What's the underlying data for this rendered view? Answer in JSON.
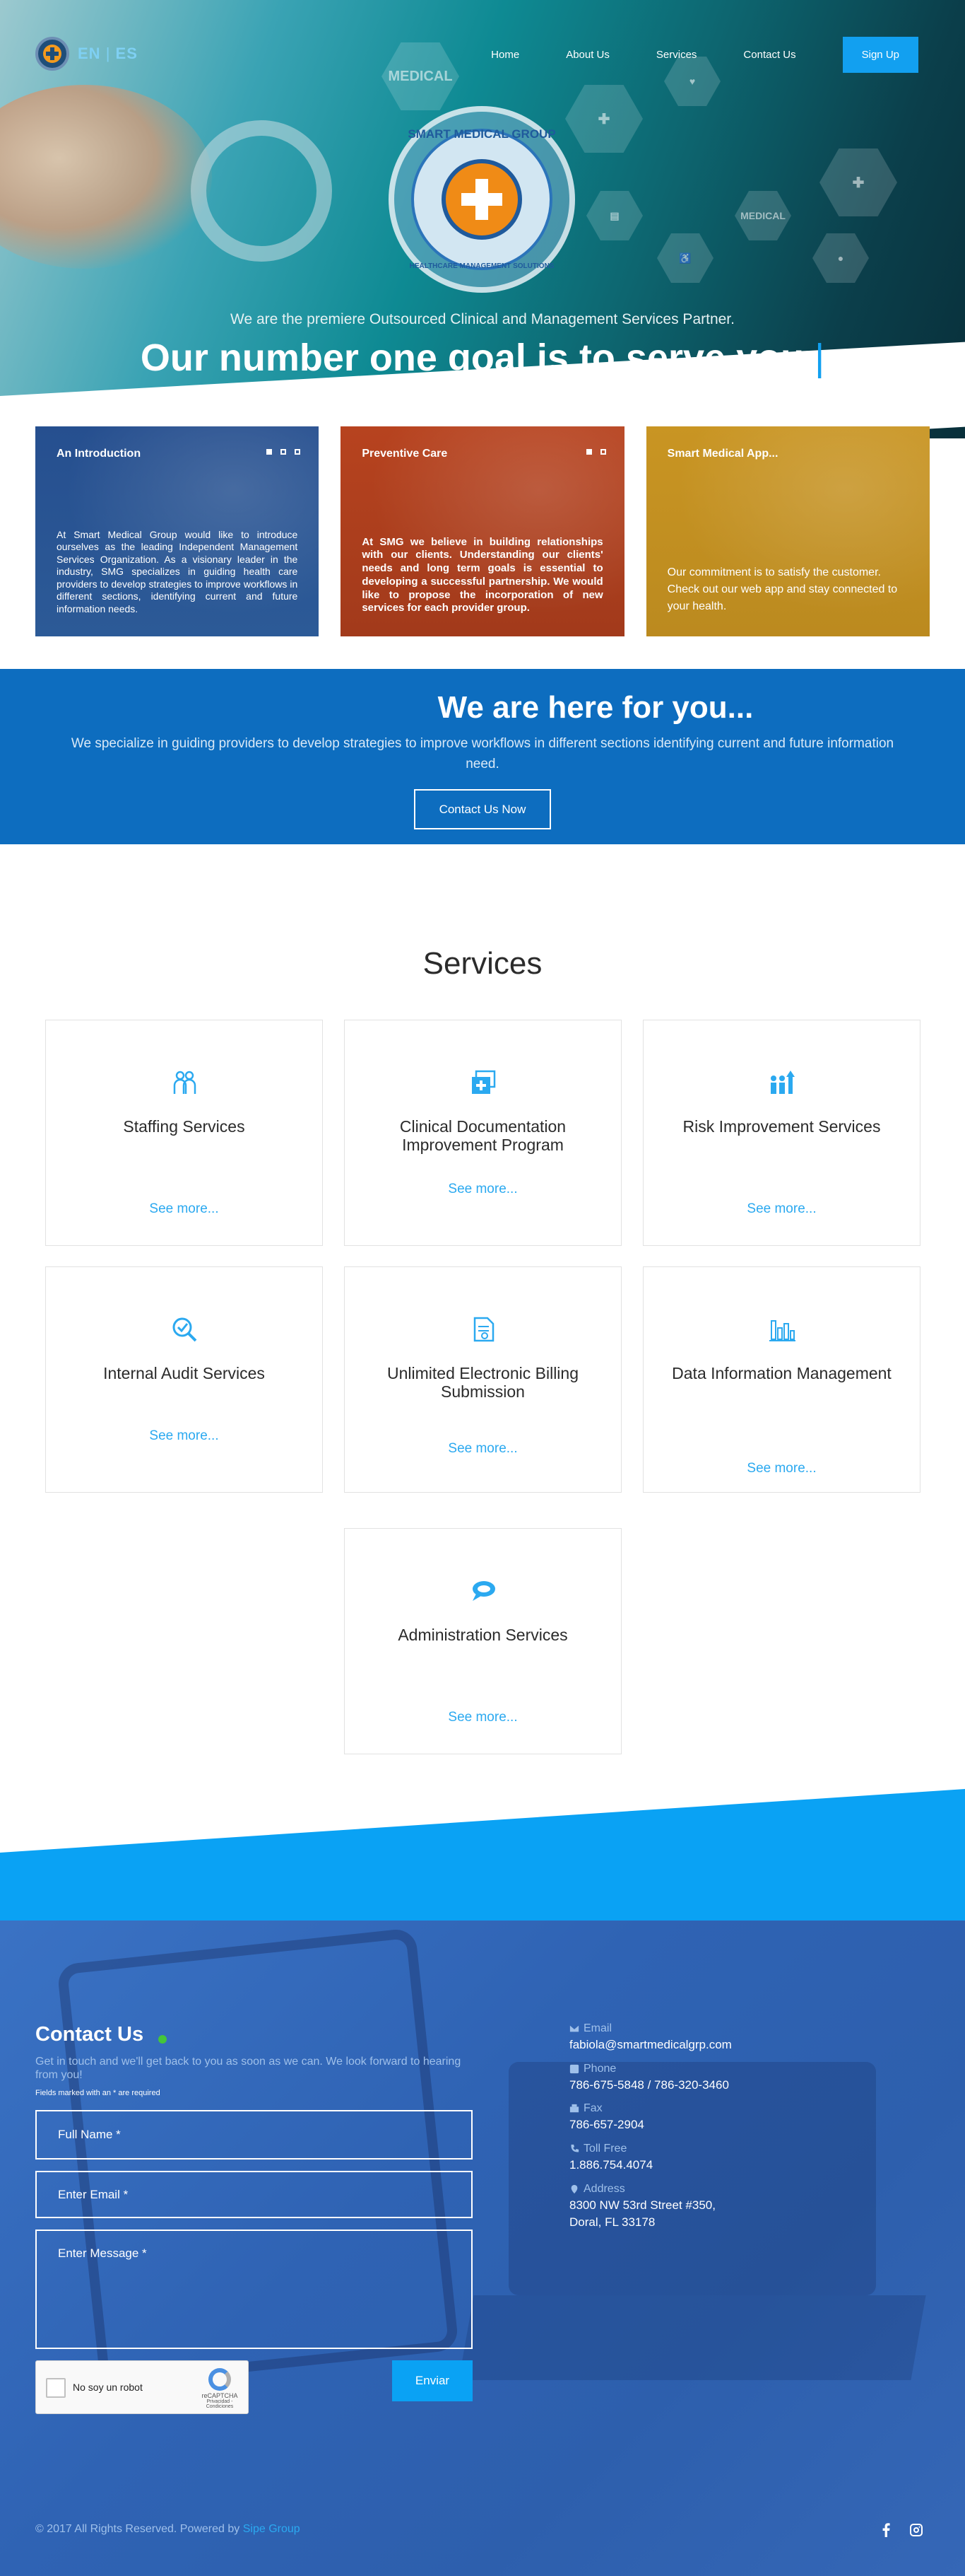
{
  "nav": {
    "lang_en": "EN",
    "lang_sep": "|",
    "lang_es": "ES",
    "links": [
      "Home",
      "About Us",
      "Services",
      "Contact Us"
    ],
    "signup": "Sign Up"
  },
  "hero": {
    "seal_top": "SMART MEDICAL GROUP",
    "seal_bottom": "HEALTHCARE MANAGEMENT SOLUTIONS",
    "hex_label": "MEDICAL",
    "subtitle": "We are the premiere Outsourced Clinical and Management Services Partner.",
    "title": "Our number one goal is to serve you",
    "cursor": "|"
  },
  "cards": [
    {
      "title": "An Introduction",
      "body": "At Smart Medical Group would like to introduce ourselves as the leading Independent Management Services Organization. As a visionary leader in the industry, SMG specializes in guiding health care providers to develop strategies to improve workflows in different sections, identifying current and future information needs."
    },
    {
      "title": "Preventive Care",
      "body": "At SMG we believe in building relationships with our clients. Understanding our clients' needs and long term goals is essential to developing a successful partnership. We would like to propose the incorporation of new services for each provider group."
    },
    {
      "title": "Smart Medical App...",
      "body": "Our commitment is to satisfy the customer. Check out our web app and stay connected to your health."
    }
  ],
  "here": {
    "title": "We are here for you...",
    "text": "We specialize in guiding providers to develop strategies to improve workflows in different sections identifying current and future information need.",
    "button": "Contact Us Now"
  },
  "services": {
    "title": "Services",
    "items": [
      {
        "name": "Staffing Services",
        "icon": "staff-icon",
        "more": "See more..."
      },
      {
        "name": "Clinical Documentation Improvement Program",
        "icon": "documents-plus-icon",
        "more": "See more..."
      },
      {
        "name": "Risk Improvement Services",
        "icon": "people-growth-icon",
        "more": "See more..."
      },
      {
        "name": "Internal Audit Services",
        "icon": "magnifier-check-icon",
        "more": "See more..."
      },
      {
        "name": "Unlimited Electronic Billing Submission",
        "icon": "billing-document-icon",
        "more": "See more..."
      },
      {
        "name": "Data Information Management",
        "icon": "bar-chart-icon",
        "more": "See more..."
      },
      {
        "name": "Administration Services",
        "icon": "chat-bubble-icon",
        "more": "See more..."
      }
    ]
  },
  "contact": {
    "title": "Contact Us",
    "lead": "Get in touch and we'll get back to you as soon as we can. We look forward to hearing from you!",
    "required_note": "Fields marked with an * are required",
    "placeholders": {
      "name": "Full Name *",
      "email": "Enter Email *",
      "message": "Enter Message *"
    },
    "captcha_label": "No soy un robot",
    "captcha_brand": "reCAPTCHA",
    "captcha_links": "Privacidad - Condiciones",
    "send": "Enviar"
  },
  "info": {
    "email_label": "Email",
    "email": "fabiola@smartmedicalgrp.com",
    "phone_label": "Phone",
    "phone": "786-675-5848 / 786-320-3460",
    "fax_label": "Fax",
    "fax": "786-657-2904",
    "toll_label": "Toll Free",
    "toll": "1.886.754.4074",
    "address_label": "Address",
    "address_line1": "8300 NW 53rd Street #350,",
    "address_line2": "Doral, FL 33178"
  },
  "footer": {
    "copyright": "© 2017 All Rights Reserved. Powered by",
    "powered": "Sipe Group"
  },
  "colors": {
    "accent": "#12a0f0",
    "here_band": "#0d6dbf",
    "contact_bg": "#2f63b4",
    "link": "#2ba9f0"
  }
}
